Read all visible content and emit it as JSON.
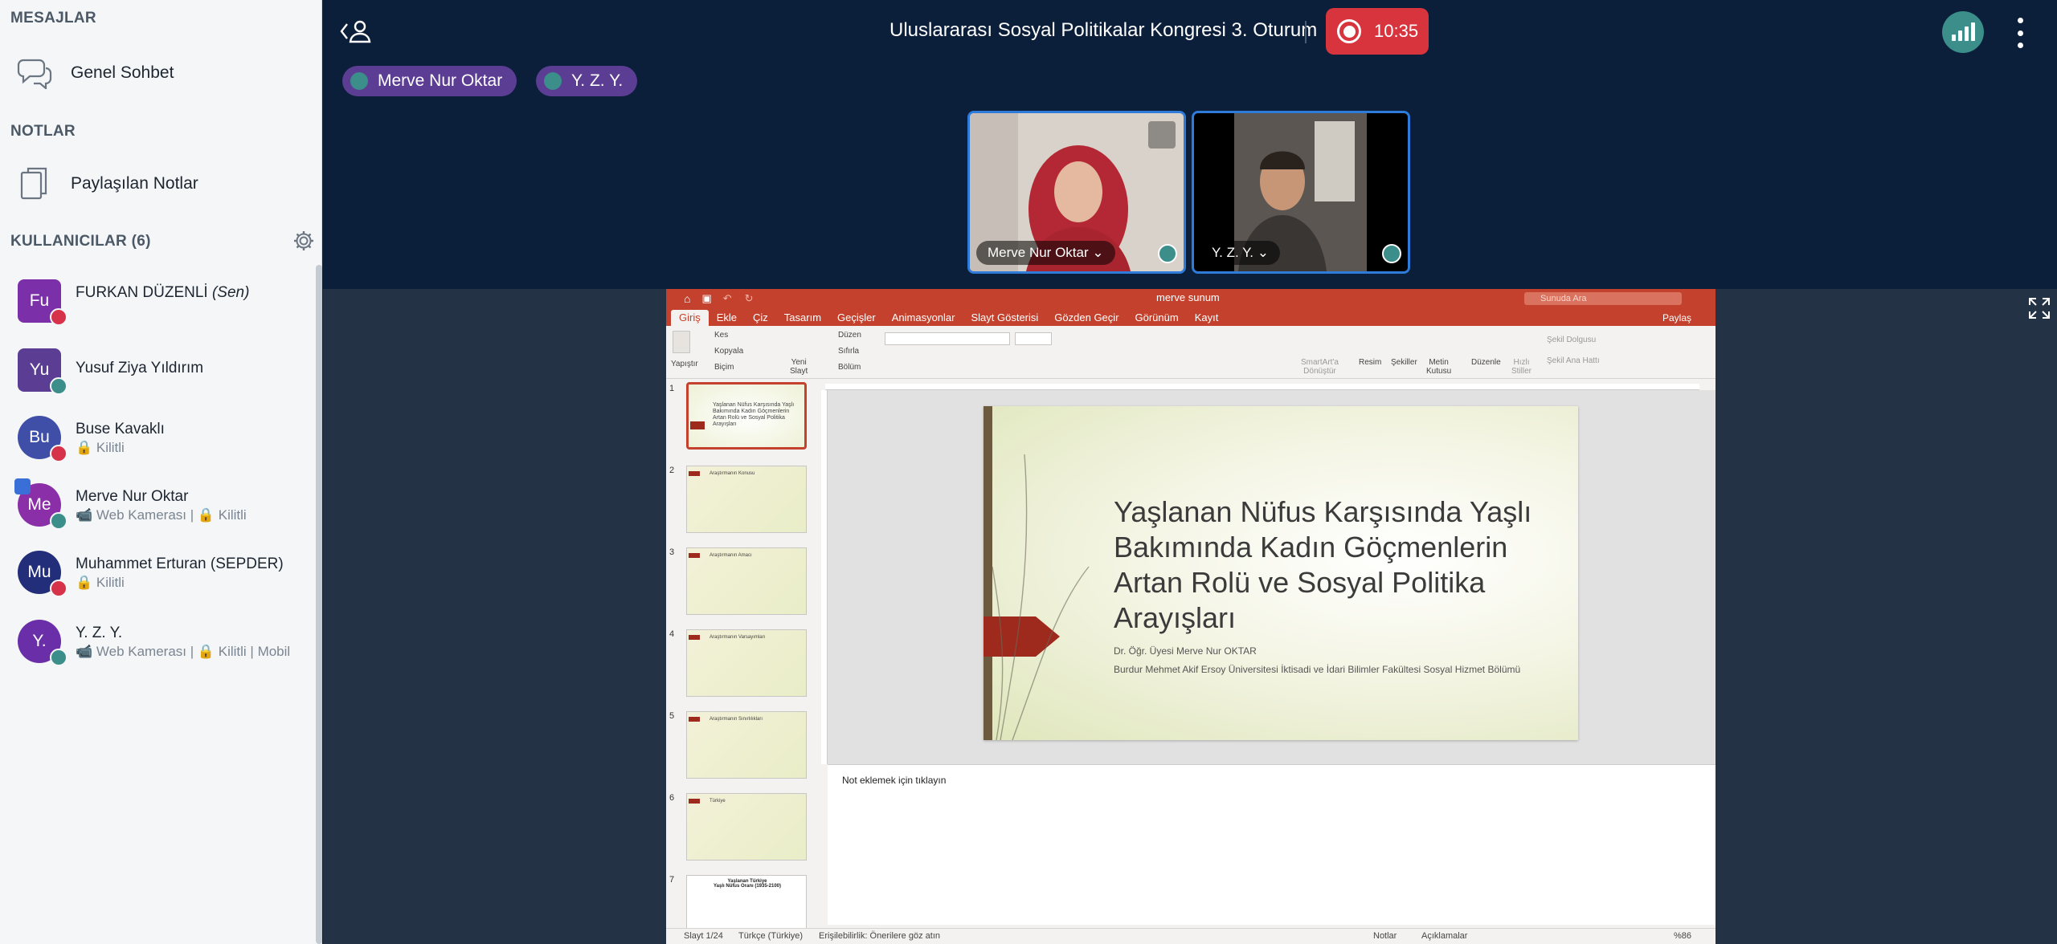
{
  "sidebar": {
    "messages_header": "MESAJLAR",
    "public_chat": "Genel Sohbet",
    "notes_header": "NOTLAR",
    "shared_notes": "Paylaşılan Notlar",
    "users_header": "KULLANICILAR (6)",
    "users": [
      {
        "initials": "Fu",
        "name": "FURKAN DÜZENLİ",
        "self_tag": "(Sen)",
        "sub": "",
        "color": "#7b2fa8",
        "status": "muted"
      },
      {
        "initials": "Yu",
        "name": "Yusuf Ziya Yıldırım",
        "sub": "",
        "color": "#5b3d94",
        "status": "listening"
      },
      {
        "initials": "Bu",
        "name": "Buse Kavaklı",
        "sub": "🔒 Kilitli",
        "color": "#3f4fa8",
        "status": "muted"
      },
      {
        "initials": "Me",
        "name": "Merve Nur Oktar",
        "sub": "📹 Web Kamerası | 🔒 Kilitli",
        "color": "#8a2fa8",
        "status": "talking"
      },
      {
        "initials": "Mu",
        "name": "Muhammet Erturan (SEPDER)",
        "sub": "🔒 Kilitli",
        "color": "#232e7a",
        "status": "muted"
      },
      {
        "initials": "Y.",
        "name": "Y. Z. Y.",
        "sub": "📹 Web Kamerası | 🔒 Kilitli | Mobil",
        "color": "#6a2fa8",
        "status": "talking"
      }
    ]
  },
  "header": {
    "title": "Uluslararası Sosyal Politikalar Kongresi 3. Oturum",
    "rec_time": "10:35"
  },
  "talkers": [
    "Merve Nur Oktar",
    "Y. Z. Y."
  ],
  "videos": [
    {
      "label": "Merve Nur Oktar ⌄"
    },
    {
      "label": "Y. Z. Y. ⌄"
    }
  ],
  "ppt": {
    "filename": "merve sunum",
    "search_placeholder": "Sunuda Ara",
    "share": "Paylaş",
    "tabs": [
      "Giriş",
      "Ekle",
      "Çiz",
      "Tasarım",
      "Geçişler",
      "Animasyonlar",
      "Slayt Gösterisi",
      "Gözden Geçir",
      "Görünüm",
      "Kayıt"
    ],
    "ribbon": {
      "paste": "Yapıştır",
      "cut": "Kes",
      "copy": "Kopyala",
      "format": "Biçim",
      "new_slide": "Yeni\nSlayt",
      "layout": "Düzen",
      "reset": "Sıfırla",
      "section": "Bölüm",
      "smartart": "SmartArt'a\nDönüştür",
      "picture": "Resim",
      "shapes": "Şekiller",
      "textbox": "Metin\nKutusu",
      "arrange": "Düzenle",
      "quick_styles": "Hızlı\nStiller",
      "shape_fill": "Şekil Dolgusu",
      "shape_outline": "Şekil Ana Hattı"
    },
    "slide_numbers": [
      "1",
      "2",
      "3",
      "4",
      "5",
      "6",
      "7"
    ],
    "thumb_title_1": "Yaşlanan Nüfus Karşısında Yaşlı Bakımında Kadın Göçmenlerin Artan Rolü ve Sosyal Politika Arayışları",
    "thumb_titles": [
      "Araştırmanın Konusu",
      "Araştırmanın Amacı",
      "Araştırmanın Varsayımları",
      "Araştırmanın Sınırlılıkları",
      "Türkiye",
      "Yaşlanan Türkiye\nYaşlı Nüfus Oranı (1935-2100)"
    ],
    "slide": {
      "title": "Yaşlanan Nüfus Karşısında Yaşlı Bakımında Kadın Göçmenlerin Artan Rolü ve Sosyal Politika Arayışları",
      "author": "Dr. Öğr. Üyesi Merve Nur OKTAR",
      "affiliation": "Burdur Mehmet Akif Ersoy Üniversitesi İktisadi ve İdari Bilimler Fakültesi Sosyal Hizmet Bölümü"
    },
    "notes_placeholder": "Not eklemek için tıklayın",
    "status": {
      "slide": "Slayt 1/24",
      "lang": "Türkçe (Türkiye)",
      "access": "Erişilebilirlik: Önerilere göz atın",
      "notes": "Notlar",
      "comments": "Açıklamalar",
      "zoom": "%86"
    }
  },
  "colors": {
    "accent": "#3b8e8a",
    "record": "#d8343e",
    "talker": "#5b3d94",
    "ppt": "#c4422d"
  }
}
